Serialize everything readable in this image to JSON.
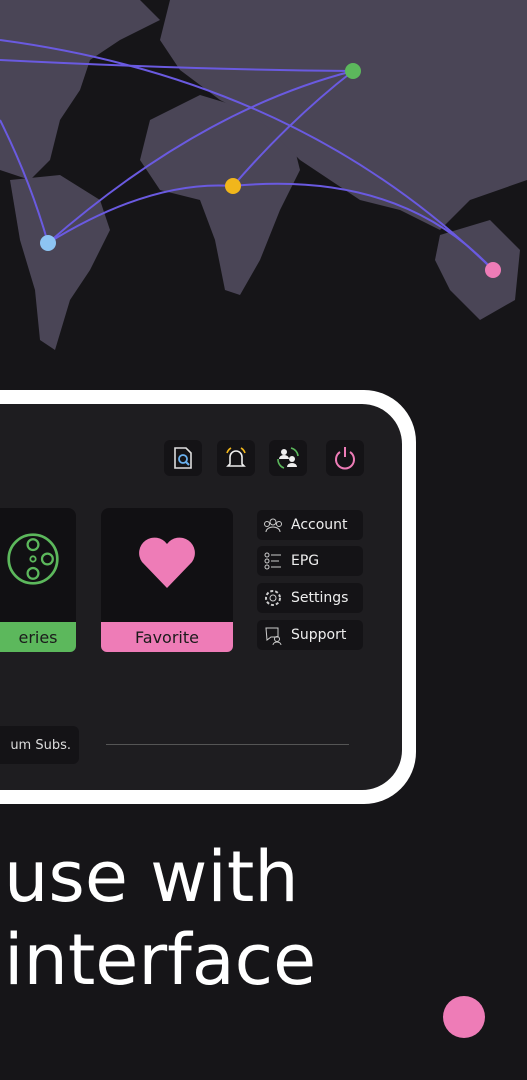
{
  "map": {
    "colors": {
      "land": "#4a4556",
      "route": "#6a5ae0"
    },
    "points": [
      {
        "name": "green",
        "color": "#5cb85c"
      },
      {
        "name": "yellow",
        "color": "#f1b61b"
      },
      {
        "name": "blue",
        "color": "#8dc4f2"
      },
      {
        "name": "pink",
        "color": "#ee7cb7"
      }
    ]
  },
  "toolbar": {
    "icons": [
      "search-document-icon",
      "bell-icon",
      "switch-user-icon",
      "power-icon"
    ]
  },
  "tiles": [
    {
      "label": "eries",
      "color": "#5cb85c"
    },
    {
      "label": "Favorite",
      "color": "#ee7cb7"
    }
  ],
  "menu": [
    {
      "label": "Account",
      "icon": "group-icon"
    },
    {
      "label": "EPG",
      "icon": "list-icon"
    },
    {
      "label": "Settings",
      "icon": "gear-icon"
    },
    {
      "label": "Support",
      "icon": "support-icon"
    }
  ],
  "subscription": {
    "label": "um Subs."
  },
  "headline": {
    "line1": "use with",
    "line2": "interface"
  },
  "accent": "#ee7cb7"
}
